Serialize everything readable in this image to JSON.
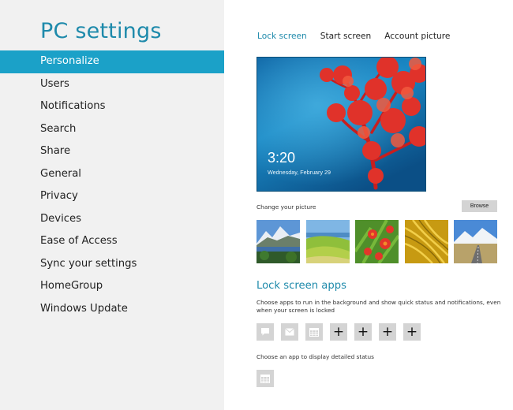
{
  "nav": {
    "title": "PC settings",
    "selected_index": 0,
    "items": [
      {
        "label": "Personalize"
      },
      {
        "label": "Users"
      },
      {
        "label": "Notifications"
      },
      {
        "label": "Search"
      },
      {
        "label": "Share"
      },
      {
        "label": "General"
      },
      {
        "label": "Privacy"
      },
      {
        "label": "Devices"
      },
      {
        "label": "Ease of Access"
      },
      {
        "label": "Sync your settings"
      },
      {
        "label": "HomeGroup"
      },
      {
        "label": "Windows Update"
      }
    ]
  },
  "tabs": [
    {
      "label": "Lock screen",
      "active": true
    },
    {
      "label": "Start screen",
      "active": false
    },
    {
      "label": "Account picture",
      "active": false
    }
  ],
  "preview": {
    "time": "3:20",
    "date": "Wednesday, February 29"
  },
  "change_picture": {
    "label": "Change your picture",
    "browse_label": "Browse",
    "thumbnails": [
      {
        "icon": "mountain-lake-thumbnail"
      },
      {
        "icon": "green-hills-thumbnail"
      },
      {
        "icon": "red-flowers-thumbnail"
      },
      {
        "icon": "golden-grass-thumbnail"
      },
      {
        "icon": "mountain-road-thumbnail"
      }
    ]
  },
  "lock_apps": {
    "title": "Lock screen apps",
    "description": "Choose apps to run in the background and show quick status and notifications, even when your screen is locked",
    "slots": [
      {
        "icon": "messaging-icon",
        "filled": true
      },
      {
        "icon": "mail-icon",
        "filled": true
      },
      {
        "icon": "calendar-icon",
        "filled": true
      },
      {
        "icon": "plus-icon",
        "filled": false
      },
      {
        "icon": "plus-icon",
        "filled": false
      },
      {
        "icon": "plus-icon",
        "filled": false
      },
      {
        "icon": "plus-icon",
        "filled": false
      }
    ],
    "detail_label": "Choose an app to display detailed status",
    "detail_icon": "calendar-icon"
  },
  "colors": {
    "accent": "#1ba1c8",
    "title": "#1e8aab",
    "nav_bg": "#f1f1f1",
    "slot_bg": "#d4d4d4"
  }
}
